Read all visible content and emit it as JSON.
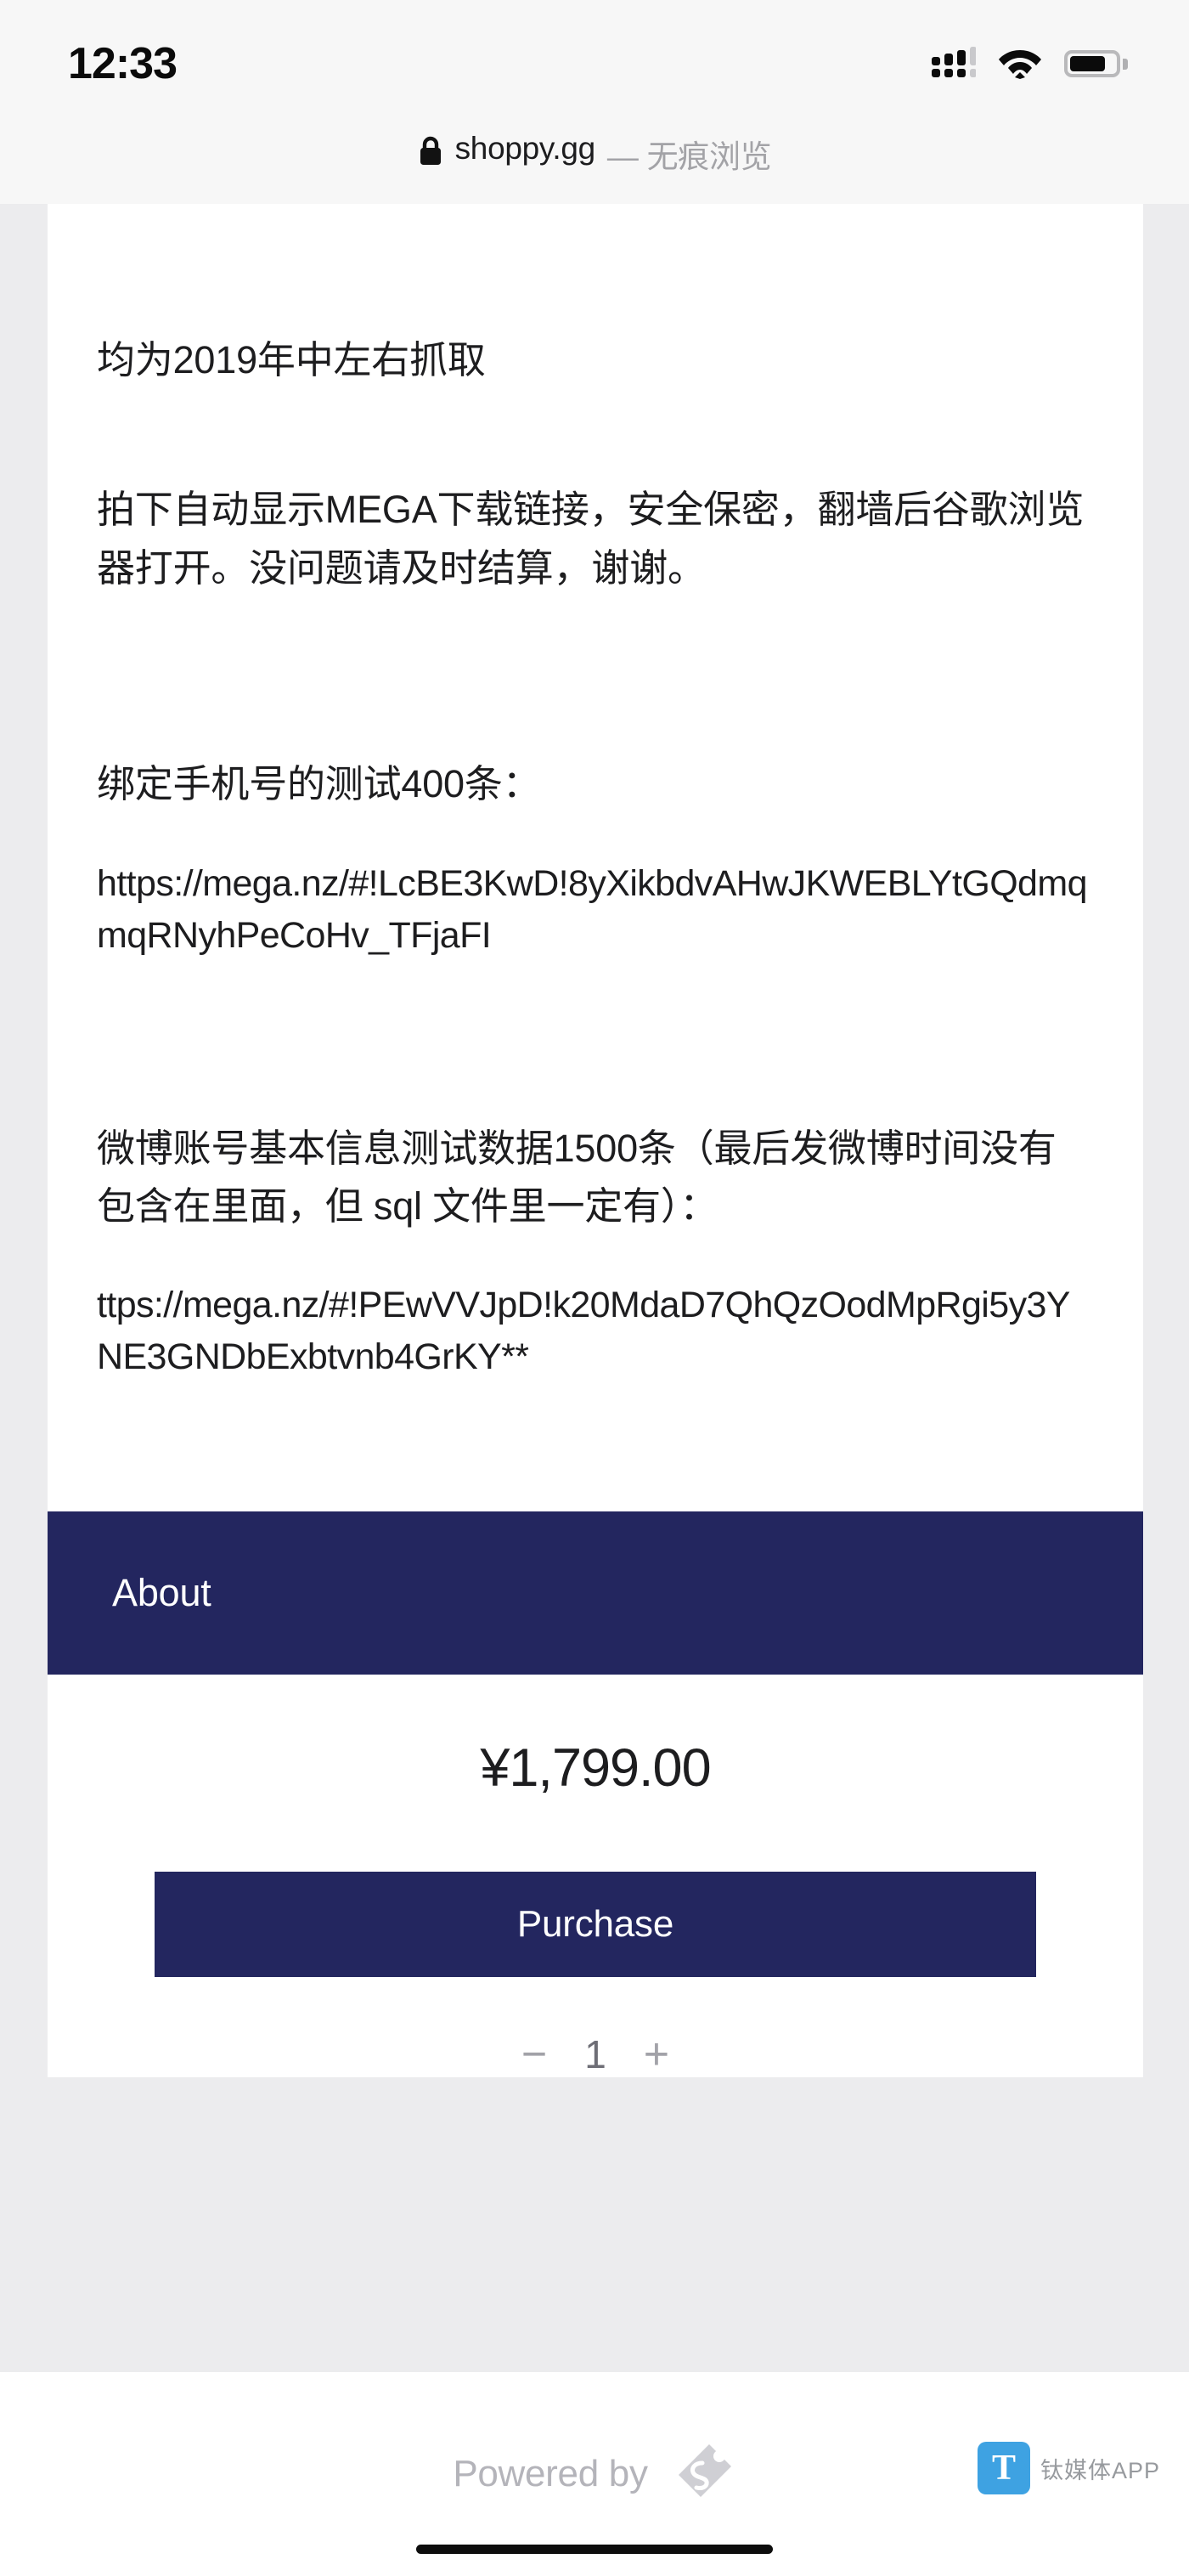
{
  "status_bar": {
    "time": "12:33",
    "signal_icon": "cellular-signal-icon",
    "wifi_icon": "wifi-icon",
    "battery_icon": "battery-icon"
  },
  "browser": {
    "lock_icon": "lock-icon",
    "domain": "shoppy.gg",
    "mode_label": "— 无痕浏览"
  },
  "content": {
    "paragraphs": [
      "均为2019年中左右抓取",
      "拍下自动显示MEGA下载链接，安全保密，翻墙后谷歌浏览器打开。没问题请及时结算，谢谢。",
      "绑定手机号的测试400条：",
      "https://mega.nz/#!LcBE3KwD!8yXikbdvAHwJKWEBLYtGQdmqmqRNyhPeCoHv_TFjaFI",
      "微博账号基本信息测试数据1500条（最后发微博时间没有包含在里面，但 sql 文件里一定有）：",
      "ttps://mega.nz/#!PEwVVJpD!k20MdaD7QhQzOodMpRgi5y3YNE3GNDbExbtvnb4GrKY**"
    ]
  },
  "about": {
    "label": "About"
  },
  "purchase": {
    "price": "¥1,799.00",
    "button_label": "Purchase",
    "decrement_label": "−",
    "quantity": "1",
    "increment_label": "+"
  },
  "footer": {
    "powered_by": "Powered by",
    "logo_icon": "shoppy-tag-logo-icon"
  },
  "watermark": {
    "badge": "T",
    "text": "钛媒体APP"
  },
  "colors": {
    "brand_navy": "#23265f",
    "page_background": "#ececee",
    "card_background": "#ffffff",
    "status_background": "#f7f7f7",
    "muted_text": "#a3a3a7"
  }
}
